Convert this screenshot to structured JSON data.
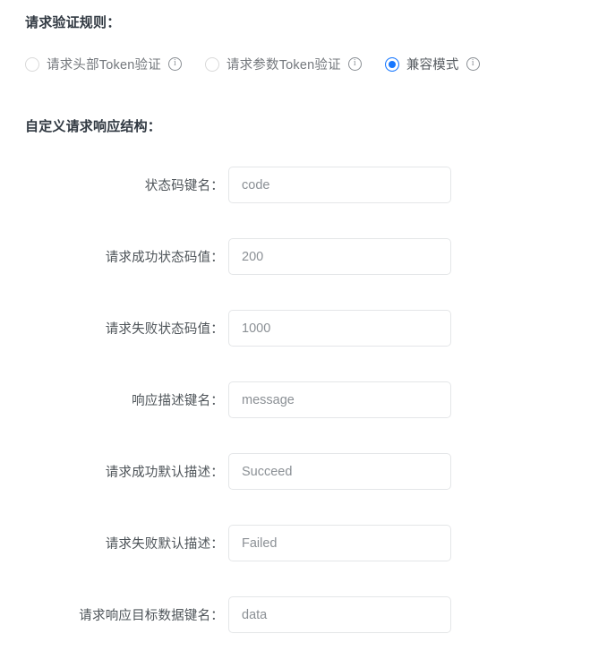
{
  "colors": {
    "accent": "#1677ff",
    "label_text": "#4e5459",
    "heading_text": "#313942",
    "input_text": "#8b9095",
    "input_border": "#e4e6e8",
    "radio_border": "#d9d9d9",
    "background": "#ffffff"
  },
  "rules_section": {
    "heading": "请求验证规则：",
    "options": [
      {
        "label": "请求头部Token验证",
        "selected": false,
        "info_icon": "info-circle-icon"
      },
      {
        "label": "请求参数Token验证",
        "selected": false,
        "info_icon": "info-circle-icon"
      },
      {
        "label": "兼容模式",
        "selected": true,
        "info_icon": "info-circle-icon"
      }
    ]
  },
  "structure_section": {
    "heading": "自定义请求响应结构：",
    "fields": [
      {
        "label": "状态码键名：",
        "value": "code",
        "placeholder": "code"
      },
      {
        "label": "请求成功状态码值：",
        "value": "200",
        "placeholder": "200"
      },
      {
        "label": "请求失败状态码值：",
        "value": "1000",
        "placeholder": "1000"
      },
      {
        "label": "响应描述键名：",
        "value": "message",
        "placeholder": "message"
      },
      {
        "label": "请求成功默认描述：",
        "value": "Succeed",
        "placeholder": "Succeed"
      },
      {
        "label": "请求失败默认描述：",
        "value": "Failed",
        "placeholder": "Failed"
      },
      {
        "label": "请求响应目标数据键名：",
        "value": "data",
        "placeholder": "data"
      }
    ]
  }
}
